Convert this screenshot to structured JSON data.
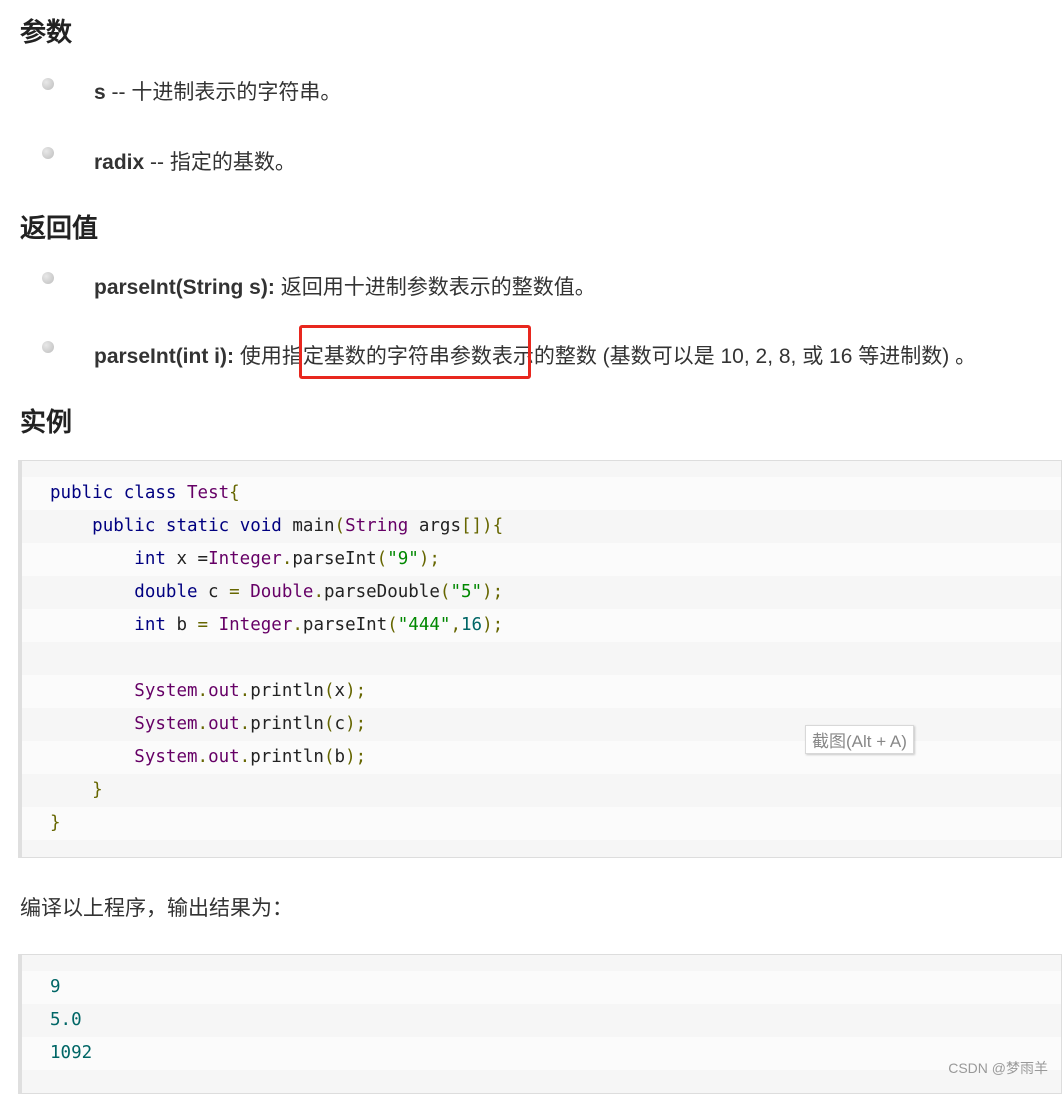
{
  "sections": {
    "params_title": "参数",
    "return_title": "返回值",
    "example_title": "实例"
  },
  "params": [
    {
      "name": "s",
      "desc": " -- 十进制表示的字符串。"
    },
    {
      "name": "radix",
      "desc": " -- 指定的基数。"
    }
  ],
  "returns": [
    {
      "name": "parseInt(String s):",
      "desc": " 返回用十进制参数表示的整数值。"
    },
    {
      "name": "parseInt(int i):",
      "desc": " 使用指定基数的字符串参数表示的整数 (基数可以是 10, 2, 8, 或 16 等进制数) 。"
    }
  ],
  "code_lines": [
    "public class Test{",
    "    public static void main(String args[]){",
    "        int x =Integer.parseInt(\"9\");",
    "        double c = Double.parseDouble(\"5\");",
    "        int b = Integer.parseInt(\"444\",16);",
    "",
    "        System.out.println(x);",
    "        System.out.println(c);",
    "        System.out.println(b);",
    "    }",
    "}"
  ],
  "compile_text": "编译以上程序，输出结果为：",
  "output_lines": [
    "9",
    "5.0",
    "1092"
  ],
  "tooltip": "截图(Alt + A)",
  "watermark": "CSDN @梦雨羊",
  "colors": {
    "highlight_border": "#e8271e",
    "keyword": "#000080",
    "class": "#660066",
    "string": "#008800",
    "number": "#006666"
  }
}
